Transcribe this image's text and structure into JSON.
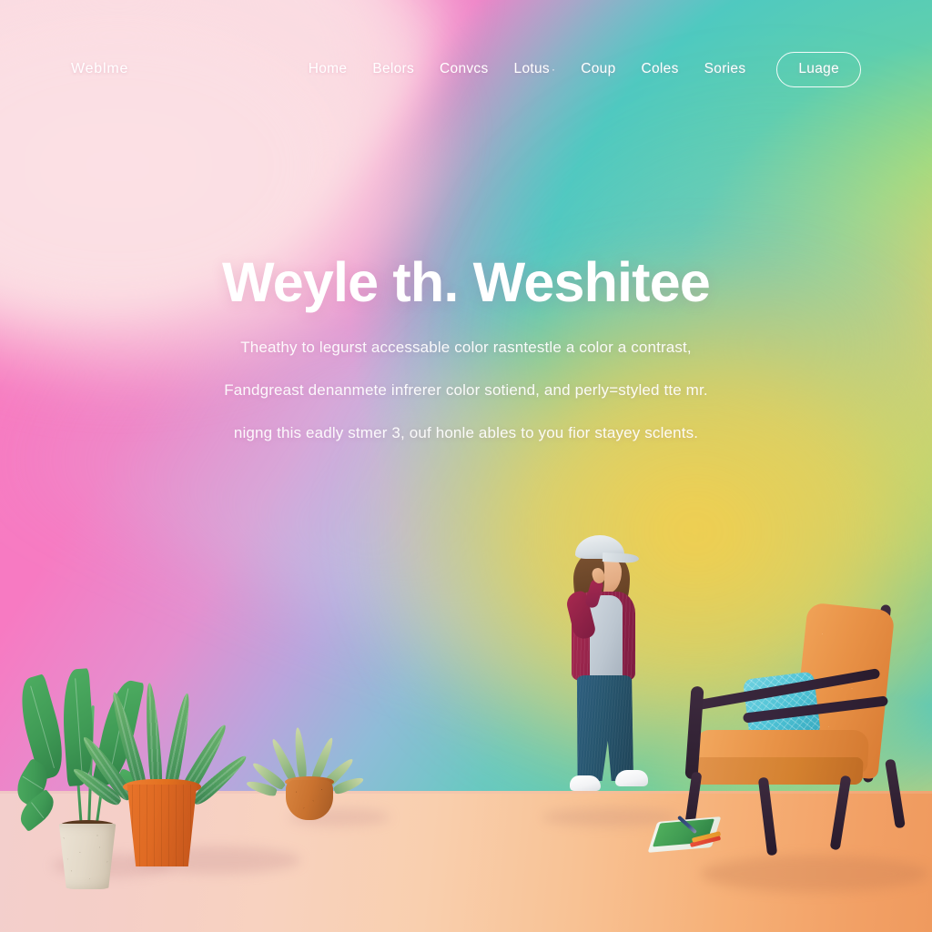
{
  "brand": {
    "name": "Weblme"
  },
  "nav": {
    "items": [
      {
        "label": "Home",
        "caret": ""
      },
      {
        "label": "Belors",
        "caret": ""
      },
      {
        "label": "Convcs",
        "caret": ""
      },
      {
        "label": "Lotus",
        "caret": "·"
      },
      {
        "label": "Coup",
        "caret": ""
      },
      {
        "label": "Coles",
        "caret": ""
      },
      {
        "label": "Sories",
        "caret": ""
      }
    ],
    "cta_label": "Luage"
  },
  "hero": {
    "title": "Weyle th. Weshitee",
    "lines": [
      "Theathy to legurst accessable color rasntestle a color a contrast,",
      "Fandgreast denanmete infrerer color sotiend, and perly=styled tte mr.",
      "nigng this eadly stmer 3, ouf honle ables to you fior stayey sclents."
    ]
  },
  "illustration": {
    "objects": [
      {
        "name": "potted-plant-large-cream",
        "description": "Large leafy plant in a speckled cream pot"
      },
      {
        "name": "potted-plant-snake-terracotta",
        "description": "Snake plant in an orange terracotta pot"
      },
      {
        "name": "potted-plant-small-round",
        "description": "Small succulent in a round terracotta pot"
      },
      {
        "name": "person-walking",
        "description": "Person in a cap, maroon jacket, grey tee, blue jeans and white sneakers"
      },
      {
        "name": "armchair",
        "description": "Mid-century orange armchair with dark wood frame"
      },
      {
        "name": "throw-cushion",
        "description": "Turquoise patterned cushion on the armchair"
      },
      {
        "name": "notebook-and-pens",
        "description": "Green notebook with a pen and coloured pencils on the floor"
      }
    ]
  },
  "colors": {
    "pink": "#f77cc0",
    "pale_pink": "#fbdfe4",
    "teal": "#4fc9c0",
    "green": "#58ccae",
    "yellow": "#f9d64e",
    "lavender": "#b9a5dd",
    "floor_left": "#f3cfcc",
    "floor_right": "#ef9a5e",
    "text_on_hero": "#ffffff",
    "terracotta": "#df6a23",
    "chair_orange": "#e89146",
    "cushion_teal": "#4fc3d6",
    "jacket_maroon": "#93234a",
    "jeans_blue": "#27566f",
    "frame_dark": "#2e1f31"
  }
}
